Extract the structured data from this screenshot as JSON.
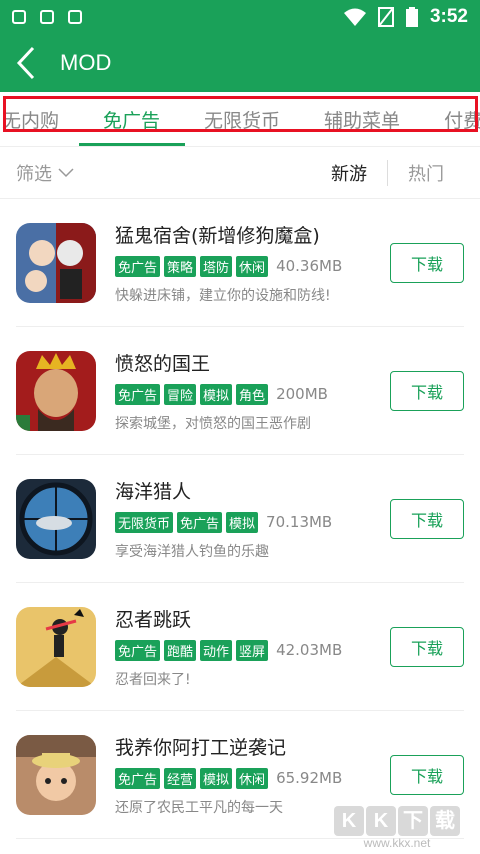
{
  "status_bar": {
    "time": "3:52"
  },
  "header": {
    "title": "MOD"
  },
  "tabs": [
    {
      "label": "无内购"
    },
    {
      "label": "免广告"
    },
    {
      "label": "无限货币"
    },
    {
      "label": "辅助菜单"
    },
    {
      "label": "付费"
    }
  ],
  "filter": {
    "label": "筛选",
    "sort_new": "新游",
    "sort_hot": "热门"
  },
  "apps": [
    {
      "name": "猛鬼宿舍(新增修狗魔盒)",
      "tags": [
        "免广告",
        "策略",
        "塔防",
        "休闲"
      ],
      "size": "40.36MB",
      "desc": "快躲进床铺，建立你的设施和防线!",
      "button": "下载"
    },
    {
      "name": "愤怒的国王",
      "tags": [
        "免广告",
        "冒险",
        "模拟",
        "角色"
      ],
      "size": "200MB",
      "desc": "探索城堡，对愤怒的国王恶作剧",
      "button": "下载"
    },
    {
      "name": "海洋猎人",
      "tags": [
        "无限货币",
        "免广告",
        "模拟"
      ],
      "size": "70.13MB",
      "desc": "享受海洋猎人钓鱼的乐趣",
      "button": "下载"
    },
    {
      "name": "忍者跳跃",
      "tags": [
        "免广告",
        "跑酷",
        "动作",
        "竖屏"
      ],
      "size": "42.03MB",
      "desc": "忍者回来了!",
      "button": "下载"
    },
    {
      "name": "我养你阿打工逆袭记",
      "tags": [
        "免广告",
        "经营",
        "模拟",
        "休闲"
      ],
      "size": "65.92MB",
      "desc": "还原了农民工平凡的每一天",
      "button": "下载"
    }
  ],
  "watermark": {
    "logo": [
      "K",
      "K",
      "下",
      "载"
    ],
    "url": "www.kkx.net"
  },
  "colors": {
    "brand": "#1aa159",
    "highlight": "#e81123"
  }
}
